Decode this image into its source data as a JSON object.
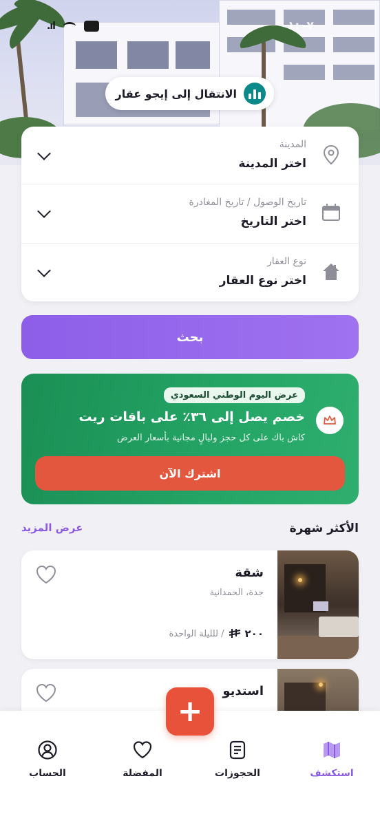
{
  "status_bar": {
    "time": "١:٠٧"
  },
  "header": {
    "navigate_label": "الانتقال إلى إيجو عقار"
  },
  "search": {
    "fields": [
      {
        "label": "المدينة",
        "value": "اختر المدينة",
        "icon": "location-pin-icon"
      },
      {
        "label": "تاريخ الوصول / تاريخ المغادرة",
        "value": "اختر التاريخ",
        "icon": "calendar-icon"
      },
      {
        "label": "نوع العقار",
        "value": "اختر نوع العقار",
        "icon": "house-icon"
      }
    ],
    "button_label": "بحث"
  },
  "promo": {
    "badge": "عرض اليوم الوطني السعودي",
    "headline": "خصم يصل إلى ٣٦٪ على باقات ريت",
    "subtitle": "كاش باك على كل حجز وليالٍ مجانية بأسعار العرض",
    "cta_label": "اشترك الآن",
    "color_bg": "#24a566",
    "color_cta": "#e4573f"
  },
  "popular": {
    "title": "الأكثر شهرة",
    "see_more": "عرض المزيد",
    "listings": [
      {
        "title": "شقة",
        "location": "جدة، الحمدانية",
        "price": "٢٠٠",
        "per": "/ للليلة الواحدة"
      },
      {
        "title": "استديو",
        "location": "",
        "price": "",
        "per": ""
      }
    ]
  },
  "bottom_nav": {
    "tabs": [
      {
        "label": "استكشف",
        "icon": "map-icon",
        "active": true
      },
      {
        "label": "الحجوزات",
        "icon": "bookings-icon",
        "active": false
      },
      {
        "label": "المفضلة",
        "icon": "heart-icon",
        "active": false
      },
      {
        "label": "الحساب",
        "icon": "user-icon",
        "active": false
      }
    ]
  },
  "colors": {
    "accent": "#8a5ae3",
    "fab": "#e8523a"
  }
}
